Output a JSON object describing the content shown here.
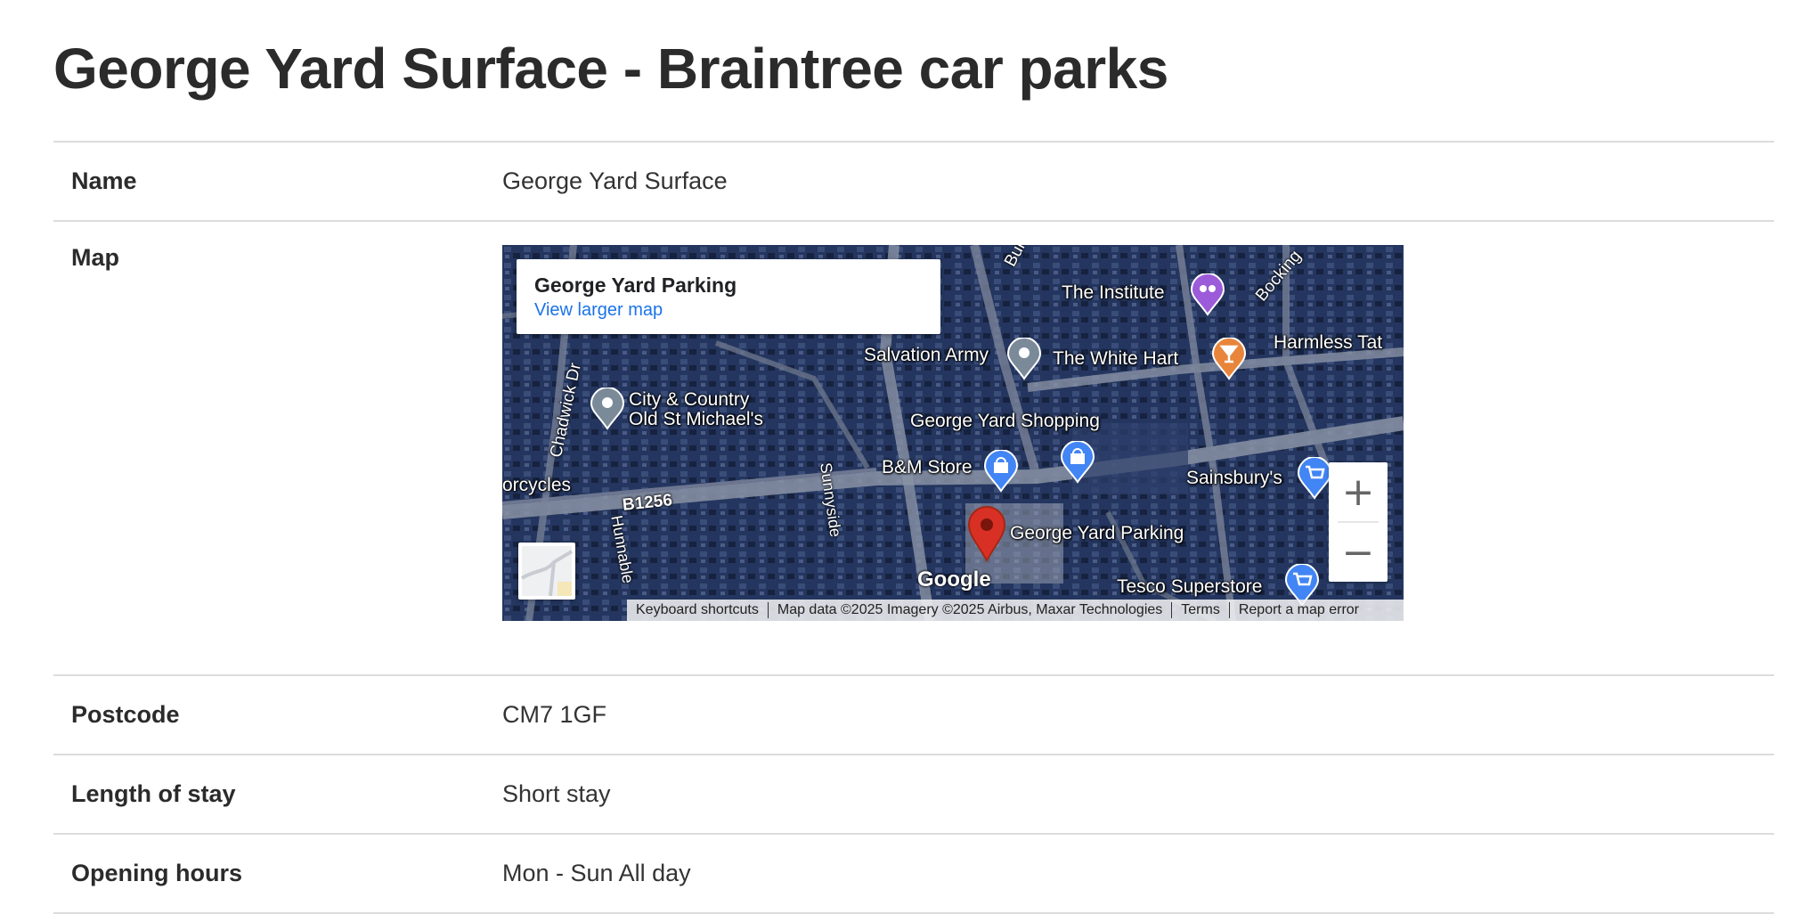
{
  "page": {
    "title": "George Yard Surface - Braintree car parks"
  },
  "details": {
    "name_label": "Name",
    "name_value": "George Yard Surface",
    "map_label": "Map",
    "postcode_label": "Postcode",
    "postcode_value": "CM7 1GF",
    "stay_label": "Length of stay",
    "stay_value": "Short stay",
    "hours_label": "Opening hours",
    "hours_value": "Mon - Sun All day"
  },
  "map": {
    "card_title": "George Yard Parking",
    "card_link": "View larger map",
    "places": {
      "institute": "The Institute",
      "harmless": "Harmless Tat",
      "salvation": "Salvation Army",
      "white_hart": "The White Hart",
      "city_country": "City & Country",
      "old_st_michaels": "Old St Michael's",
      "george_yard_shopping": "George Yard Shopping",
      "bm_store": "B&M Store",
      "sainsburys": "Sainsbury's",
      "george_yard_parking": "George Yard Parking",
      "tesco": "Tesco Superstore",
      "motorcycles": "orcycles"
    },
    "roads": {
      "bunyan": "Bunyan Rd",
      "bocking": "Bocking",
      "chadwick": "Chadwick Dr",
      "sunnyside": "Sunnyside",
      "b1256": "B1256",
      "hunnable": "Hunnable"
    },
    "zoom_in": "+",
    "zoom_out": "−",
    "google": "Google",
    "attribution": {
      "shortcuts": "Keyboard shortcuts",
      "data": "Map data ©2025 Imagery ©2025 Airbus, Maxar Technologies",
      "terms": "Terms",
      "report": "Report a map error"
    },
    "colors": {
      "marker_red": "#d93025",
      "poi_gray": "#7b8a99",
      "poi_blue": "#4285f4",
      "poi_orange": "#e8853b",
      "poi_purple": "#9c5bd8",
      "link_blue": "#1a73e8"
    }
  }
}
